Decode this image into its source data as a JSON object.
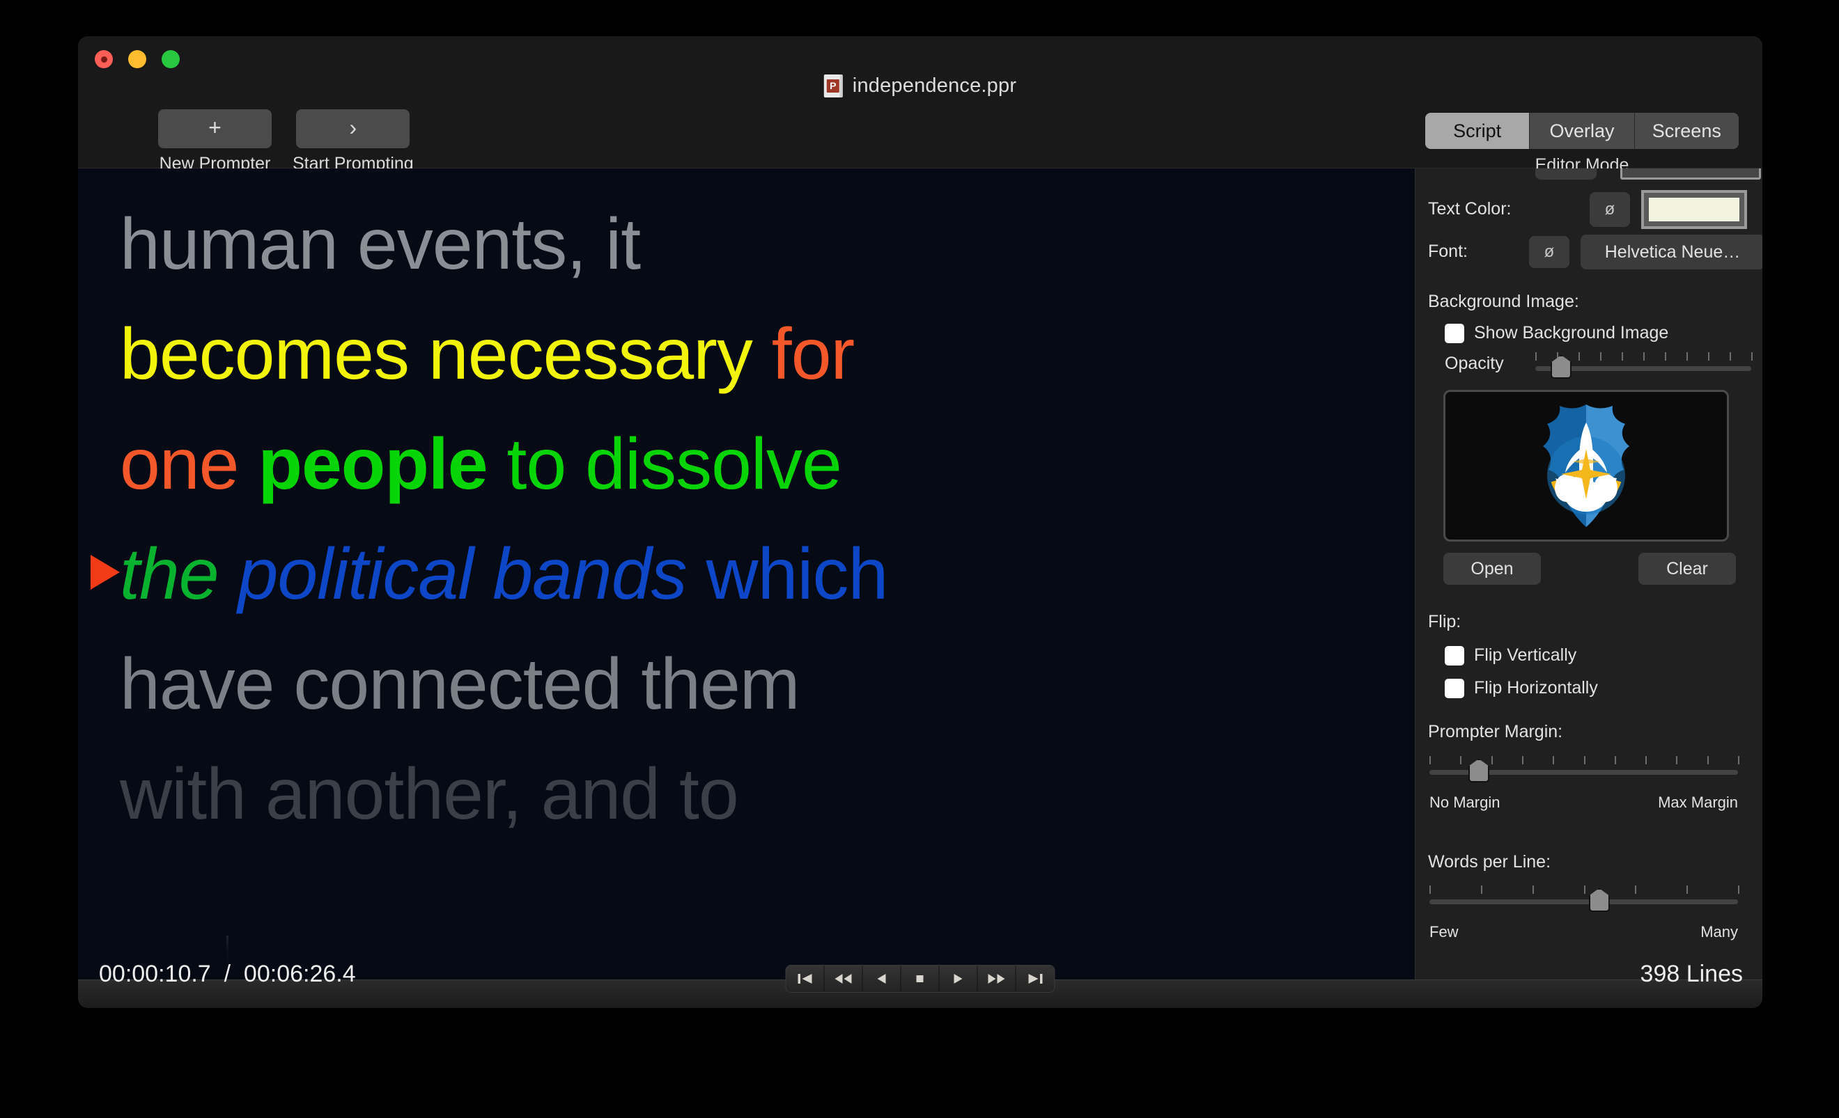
{
  "window": {
    "title": "independence.ppr",
    "doc_icon": "presentation-file-icon",
    "traffic_lights": [
      "close",
      "minimize",
      "maximize"
    ]
  },
  "toolbar": {
    "items": [
      {
        "icon": "plus-icon",
        "glyph": "+",
        "label": "New Prompter"
      },
      {
        "icon": "chevron-right-icon",
        "glyph": "›",
        "label": "Start Prompting"
      }
    ]
  },
  "editor_mode": {
    "caption": "Editor Mode",
    "segments": [
      {
        "label": "Script",
        "selected": true
      },
      {
        "label": "Overlay",
        "selected": false
      },
      {
        "label": "Screens",
        "selected": false
      }
    ]
  },
  "prompter": {
    "background_color": "#060a14",
    "cue_marker_color": "#f43b17",
    "lines": [
      {
        "words": [
          {
            "text": "human events, it",
            "color": "#8a8f96",
            "style": "normal",
            "weight": "normal"
          }
        ]
      },
      {
        "words": [
          {
            "text": "becomes necessary",
            "color": "#f2f40a",
            "style": "normal",
            "weight": "normal"
          },
          {
            "text": " ",
            "color": "#8a8f96",
            "style": "normal",
            "weight": "normal"
          },
          {
            "text": "for",
            "color": "#f4582a",
            "style": "normal",
            "weight": "normal"
          }
        ]
      },
      {
        "words": [
          {
            "text": "one",
            "color": "#f4582a",
            "style": "normal",
            "weight": "normal"
          },
          {
            "text": " ",
            "color": "#8a8f96",
            "style": "normal",
            "weight": "normal"
          },
          {
            "text": "people",
            "color": "#06d406",
            "style": "normal",
            "weight": "bold"
          },
          {
            "text": " to dissolve",
            "color": "#06d406",
            "style": "normal",
            "weight": "normal"
          }
        ]
      },
      {
        "words": [
          {
            "text": "the",
            "color": "#06b22e",
            "style": "italic",
            "weight": "normal"
          },
          {
            "text": " ",
            "color": "#8a8f96",
            "style": "normal",
            "weight": "normal"
          },
          {
            "text": "political bands",
            "color": "#0d47c8",
            "style": "italic",
            "weight": "normal"
          },
          {
            "text": " ",
            "color": "#8a8f96",
            "style": "normal",
            "weight": "normal"
          },
          {
            "text": "which",
            "color": "#0d47c8",
            "style": "normal",
            "weight": "normal"
          }
        ]
      },
      {
        "words": [
          {
            "text": "have connected them",
            "color": "#7b8086",
            "style": "normal",
            "weight": "normal"
          }
        ]
      },
      {
        "words": [
          {
            "text": "with another, and to",
            "color": "#3a4048",
            "style": "normal",
            "weight": "normal"
          }
        ]
      }
    ]
  },
  "sidebar": {
    "text_color": {
      "label": "Text Color:",
      "null_glyph": "ø",
      "swatch_color": "#f1f2e0"
    },
    "font": {
      "label": "Font:",
      "null_glyph": "ø",
      "value": "Helvetica Neue…"
    },
    "background_image": {
      "title": "Background Image:",
      "show_label": "Show Background Image",
      "show_checked": false,
      "opacity_label": "Opacity",
      "opacity_value": 12,
      "opacity_ticks": 11,
      "thumbnail_alt": "space-shuttle-shield-emblem",
      "open_label": "Open",
      "clear_label": "Clear"
    },
    "flip": {
      "title": "Flip:",
      "vertical_label": "Flip Vertically",
      "vertical_checked": false,
      "horizontal_label": "Flip Horizontally",
      "horizontal_checked": false
    },
    "prompter_margin": {
      "title": "Prompter Margin:",
      "value": 16,
      "ticks": 11,
      "min_label": "No Margin",
      "max_label": "Max Margin"
    },
    "words_per_line": {
      "title": "Words per Line:",
      "value": 55,
      "ticks": 7,
      "min_label": "Few",
      "max_label": "Many"
    }
  },
  "statusbar": {
    "current_time": "00:00:10.7",
    "separator": " / ",
    "total_time": "00:06:26.4",
    "timecode": "00:00:10.7  /  00:06:26.4",
    "lines_count": "398 Lines",
    "transport": [
      {
        "name": "skip-to-start-icon"
      },
      {
        "name": "rewind-icon"
      },
      {
        "name": "play-reverse-icon"
      },
      {
        "name": "stop-icon"
      },
      {
        "name": "play-icon"
      },
      {
        "name": "fast-forward-icon"
      },
      {
        "name": "skip-to-end-icon"
      }
    ]
  }
}
